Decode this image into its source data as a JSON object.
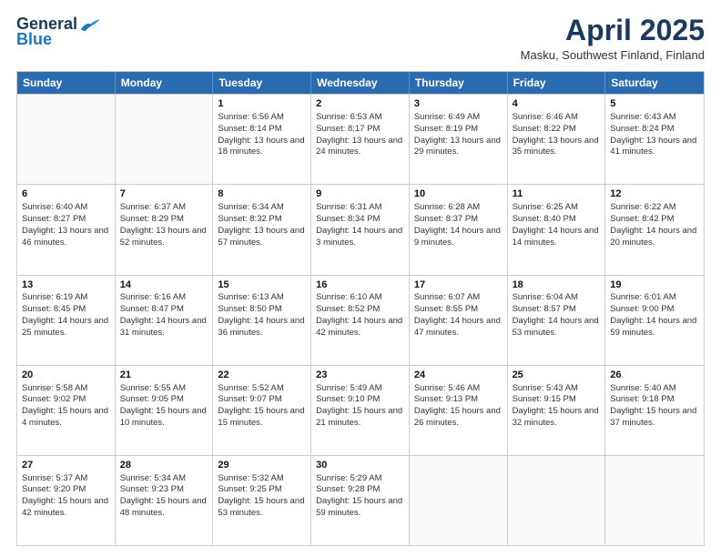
{
  "logo": {
    "general": "General",
    "blue": "Blue"
  },
  "title": "April 2025",
  "location": "Masku, Southwest Finland, Finland",
  "days": [
    "Sunday",
    "Monday",
    "Tuesday",
    "Wednesday",
    "Thursday",
    "Friday",
    "Saturday"
  ],
  "weeks": [
    [
      {
        "day": "",
        "content": ""
      },
      {
        "day": "",
        "content": ""
      },
      {
        "day": "1",
        "content": "Sunrise: 6:56 AM\nSunset: 8:14 PM\nDaylight: 13 hours and 18 minutes."
      },
      {
        "day": "2",
        "content": "Sunrise: 6:53 AM\nSunset: 8:17 PM\nDaylight: 13 hours and 24 minutes."
      },
      {
        "day": "3",
        "content": "Sunrise: 6:49 AM\nSunset: 8:19 PM\nDaylight: 13 hours and 29 minutes."
      },
      {
        "day": "4",
        "content": "Sunrise: 6:46 AM\nSunset: 8:22 PM\nDaylight: 13 hours and 35 minutes."
      },
      {
        "day": "5",
        "content": "Sunrise: 6:43 AM\nSunset: 8:24 PM\nDaylight: 13 hours and 41 minutes."
      }
    ],
    [
      {
        "day": "6",
        "content": "Sunrise: 6:40 AM\nSunset: 8:27 PM\nDaylight: 13 hours and 46 minutes."
      },
      {
        "day": "7",
        "content": "Sunrise: 6:37 AM\nSunset: 8:29 PM\nDaylight: 13 hours and 52 minutes."
      },
      {
        "day": "8",
        "content": "Sunrise: 6:34 AM\nSunset: 8:32 PM\nDaylight: 13 hours and 57 minutes."
      },
      {
        "day": "9",
        "content": "Sunrise: 6:31 AM\nSunset: 8:34 PM\nDaylight: 14 hours and 3 minutes."
      },
      {
        "day": "10",
        "content": "Sunrise: 6:28 AM\nSunset: 8:37 PM\nDaylight: 14 hours and 9 minutes."
      },
      {
        "day": "11",
        "content": "Sunrise: 6:25 AM\nSunset: 8:40 PM\nDaylight: 14 hours and 14 minutes."
      },
      {
        "day": "12",
        "content": "Sunrise: 6:22 AM\nSunset: 8:42 PM\nDaylight: 14 hours and 20 minutes."
      }
    ],
    [
      {
        "day": "13",
        "content": "Sunrise: 6:19 AM\nSunset: 8:45 PM\nDaylight: 14 hours and 25 minutes."
      },
      {
        "day": "14",
        "content": "Sunrise: 6:16 AM\nSunset: 8:47 PM\nDaylight: 14 hours and 31 minutes."
      },
      {
        "day": "15",
        "content": "Sunrise: 6:13 AM\nSunset: 8:50 PM\nDaylight: 14 hours and 36 minutes."
      },
      {
        "day": "16",
        "content": "Sunrise: 6:10 AM\nSunset: 8:52 PM\nDaylight: 14 hours and 42 minutes."
      },
      {
        "day": "17",
        "content": "Sunrise: 6:07 AM\nSunset: 8:55 PM\nDaylight: 14 hours and 47 minutes."
      },
      {
        "day": "18",
        "content": "Sunrise: 6:04 AM\nSunset: 8:57 PM\nDaylight: 14 hours and 53 minutes."
      },
      {
        "day": "19",
        "content": "Sunrise: 6:01 AM\nSunset: 9:00 PM\nDaylight: 14 hours and 59 minutes."
      }
    ],
    [
      {
        "day": "20",
        "content": "Sunrise: 5:58 AM\nSunset: 9:02 PM\nDaylight: 15 hours and 4 minutes."
      },
      {
        "day": "21",
        "content": "Sunrise: 5:55 AM\nSunset: 9:05 PM\nDaylight: 15 hours and 10 minutes."
      },
      {
        "day": "22",
        "content": "Sunrise: 5:52 AM\nSunset: 9:07 PM\nDaylight: 15 hours and 15 minutes."
      },
      {
        "day": "23",
        "content": "Sunrise: 5:49 AM\nSunset: 9:10 PM\nDaylight: 15 hours and 21 minutes."
      },
      {
        "day": "24",
        "content": "Sunrise: 5:46 AM\nSunset: 9:13 PM\nDaylight: 15 hours and 26 minutes."
      },
      {
        "day": "25",
        "content": "Sunrise: 5:43 AM\nSunset: 9:15 PM\nDaylight: 15 hours and 32 minutes."
      },
      {
        "day": "26",
        "content": "Sunrise: 5:40 AM\nSunset: 9:18 PM\nDaylight: 15 hours and 37 minutes."
      }
    ],
    [
      {
        "day": "27",
        "content": "Sunrise: 5:37 AM\nSunset: 9:20 PM\nDaylight: 15 hours and 42 minutes."
      },
      {
        "day": "28",
        "content": "Sunrise: 5:34 AM\nSunset: 9:23 PM\nDaylight: 15 hours and 48 minutes."
      },
      {
        "day": "29",
        "content": "Sunrise: 5:32 AM\nSunset: 9:25 PM\nDaylight: 15 hours and 53 minutes."
      },
      {
        "day": "30",
        "content": "Sunrise: 5:29 AM\nSunset: 9:28 PM\nDaylight: 15 hours and 59 minutes."
      },
      {
        "day": "",
        "content": ""
      },
      {
        "day": "",
        "content": ""
      },
      {
        "day": "",
        "content": ""
      }
    ]
  ]
}
